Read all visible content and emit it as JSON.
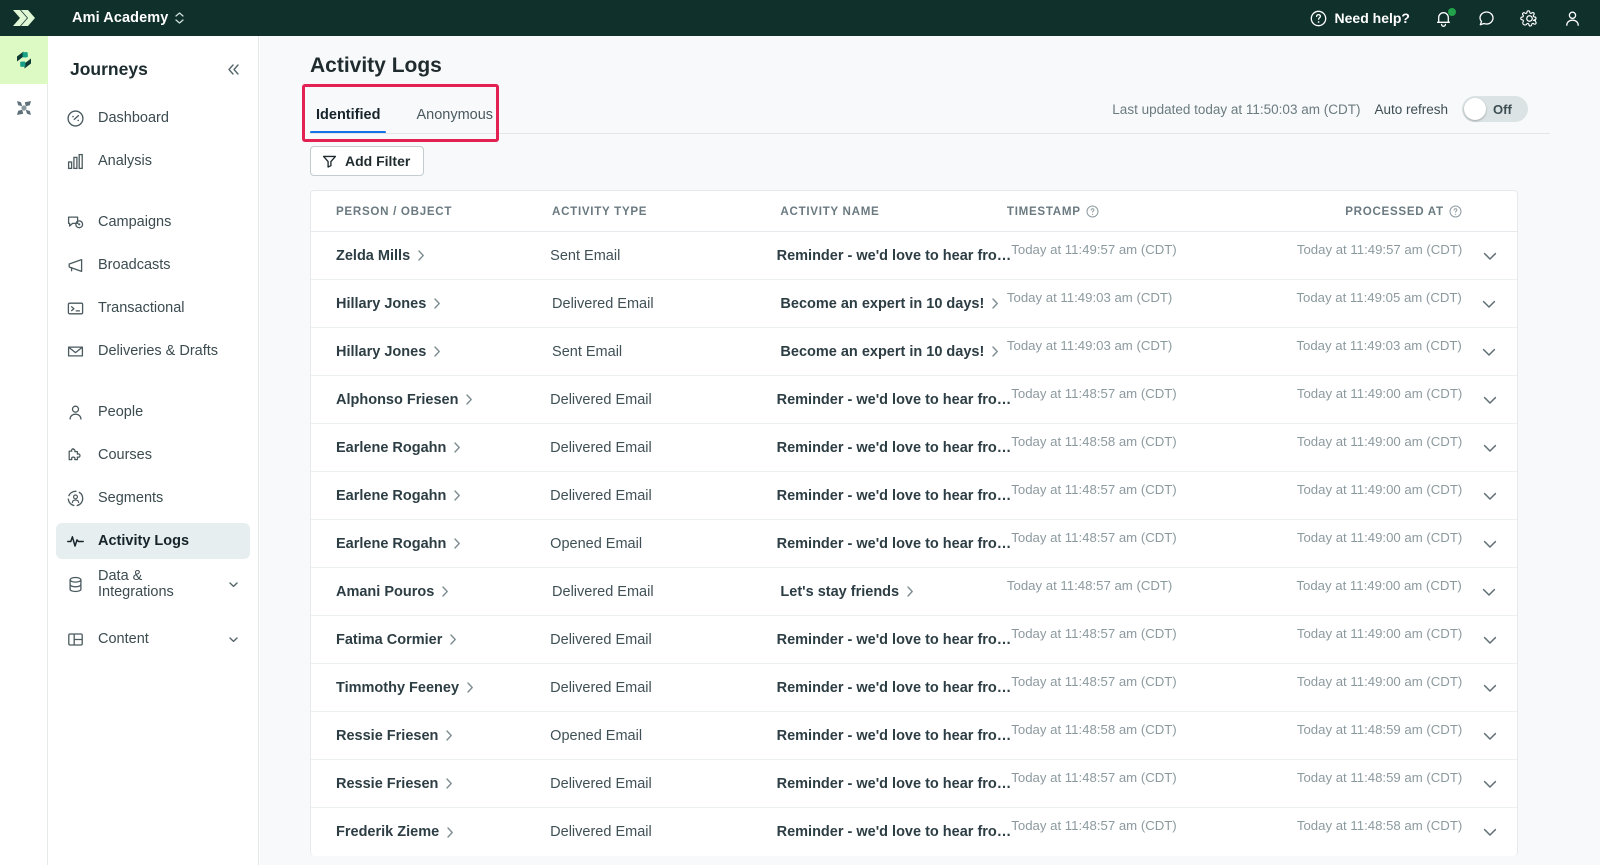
{
  "topbar": {
    "logo_icon": "brand-chevrons-icon",
    "org_name": "Ami Academy",
    "org_switch_icon": "up-down-chevrons-icon",
    "need_help": "Need help?",
    "help_icon": "question-circle-icon",
    "bell_icon": "bell-icon",
    "chat_icon": "chat-bubble-icon",
    "gear_icon": "gear-icon",
    "account_icon": "user-icon",
    "notification_dot_color": "#22a24a",
    "background": "#10302b"
  },
  "rail": {
    "items": [
      {
        "icon": "journeys-leaf-icon",
        "active": true
      },
      {
        "icon": "data-pipelines-x-icon",
        "active": false
      }
    ],
    "active_background": "#ddf9c4"
  },
  "sidebar": {
    "title": "Journeys",
    "collapse_icon": "double-chevron-left-icon",
    "items": [
      {
        "label": "Dashboard",
        "icon": "dashboard-gauge-icon",
        "active": false,
        "expandable": false
      },
      {
        "label": "Analysis",
        "icon": "bar-chart-icon",
        "active": false,
        "expandable": false
      },
      {
        "label": "Campaigns",
        "icon": "campaigns-icon",
        "active": false,
        "expandable": false
      },
      {
        "label": "Broadcasts",
        "icon": "megaphone-icon",
        "active": false,
        "expandable": false
      },
      {
        "label": "Transactional",
        "icon": "terminal-icon",
        "active": false,
        "expandable": false
      },
      {
        "label": "Deliveries & Drafts",
        "icon": "inbox-icon",
        "active": false,
        "expandable": false
      },
      {
        "label": "People",
        "icon": "person-icon",
        "active": false,
        "expandable": false
      },
      {
        "label": "Courses",
        "icon": "puzzle-icon",
        "active": false,
        "expandable": false
      },
      {
        "label": "Segments",
        "icon": "segments-circle-person-icon",
        "active": false,
        "expandable": false
      },
      {
        "label": "Activity Logs",
        "icon": "pulse-icon",
        "active": true,
        "expandable": false
      },
      {
        "label": "Data & Integrations",
        "icon": "database-icon",
        "active": false,
        "expandable": true
      },
      {
        "label": "Content",
        "icon": "content-layout-icon",
        "active": false,
        "expandable": true
      }
    ]
  },
  "main": {
    "page_title": "Activity Logs",
    "tabs": [
      {
        "label": "Identified",
        "active": true
      },
      {
        "label": "Anonymous",
        "active": false
      }
    ],
    "tab_highlight_color": "#e32253",
    "tab_active_underline_color": "#1673e6",
    "last_updated": "Last updated today at 11:50:03 am (CDT)",
    "auto_refresh_label": "Auto refresh",
    "auto_refresh_state": "Off",
    "add_filter": {
      "label": "Add Filter",
      "icon": "funnel-icon"
    },
    "table": {
      "columns": [
        {
          "label": "PERSON / OBJECT",
          "info_icon": false
        },
        {
          "label": "ACTIVITY TYPE",
          "info_icon": false
        },
        {
          "label": "ACTIVITY NAME",
          "info_icon": false
        },
        {
          "label": "TIMESTAMP",
          "info_icon": true
        },
        {
          "label": "PROCESSED AT",
          "info_icon": true
        }
      ],
      "row_chevron_icon": "chevron-down-icon",
      "link_chevron_icon": "chevron-right-icon",
      "rows": [
        {
          "person": "Zelda Mills",
          "type": "Sent Email",
          "name": "Reminder - we'd love to hear fro…",
          "name_link": false,
          "timestamp": "Today at 11:49:57 am (CDT)",
          "processed_at": "Today at 11:49:57 am (CDT)"
        },
        {
          "person": "Hillary Jones",
          "type": "Delivered Email",
          "name": "Become an expert in 10 days!",
          "name_link": true,
          "timestamp": "Today at 11:49:03 am (CDT)",
          "processed_at": "Today at 11:49:05 am (CDT)"
        },
        {
          "person": "Hillary Jones",
          "type": "Sent Email",
          "name": "Become an expert in 10 days!",
          "name_link": true,
          "timestamp": "Today at 11:49:03 am (CDT)",
          "processed_at": "Today at 11:49:03 am (CDT)"
        },
        {
          "person": "Alphonso Friesen",
          "type": "Delivered Email",
          "name": "Reminder - we'd love to hear fro…",
          "name_link": false,
          "timestamp": "Today at 11:48:57 am (CDT)",
          "processed_at": "Today at 11:49:00 am (CDT)"
        },
        {
          "person": "Earlene Rogahn",
          "type": "Delivered Email",
          "name": "Reminder - we'd love to hear fro…",
          "name_link": false,
          "timestamp": "Today at 11:48:58 am (CDT)",
          "processed_at": "Today at 11:49:00 am (CDT)"
        },
        {
          "person": "Earlene Rogahn",
          "type": "Delivered Email",
          "name": "Reminder - we'd love to hear fro…",
          "name_link": false,
          "timestamp": "Today at 11:48:57 am (CDT)",
          "processed_at": "Today at 11:49:00 am (CDT)"
        },
        {
          "person": "Earlene Rogahn",
          "type": "Opened Email",
          "name": "Reminder - we'd love to hear fro…",
          "name_link": false,
          "timestamp": "Today at 11:48:57 am (CDT)",
          "processed_at": "Today at 11:49:00 am (CDT)"
        },
        {
          "person": "Amani Pouros",
          "type": "Delivered Email",
          "name": "Let's stay friends",
          "name_link": true,
          "timestamp": "Today at 11:48:57 am (CDT)",
          "processed_at": "Today at 11:49:00 am (CDT)"
        },
        {
          "person": "Fatima Cormier",
          "type": "Delivered Email",
          "name": "Reminder - we'd love to hear fro…",
          "name_link": false,
          "timestamp": "Today at 11:48:57 am (CDT)",
          "processed_at": "Today at 11:49:00 am (CDT)"
        },
        {
          "person": "Timmothy Feeney",
          "type": "Delivered Email",
          "name": "Reminder - we'd love to hear fro…",
          "name_link": false,
          "timestamp": "Today at 11:48:57 am (CDT)",
          "processed_at": "Today at 11:49:00 am (CDT)"
        },
        {
          "person": "Ressie Friesen",
          "type": "Opened Email",
          "name": "Reminder - we'd love to hear fro…",
          "name_link": false,
          "timestamp": "Today at 11:48:58 am (CDT)",
          "processed_at": "Today at 11:48:59 am (CDT)"
        },
        {
          "person": "Ressie Friesen",
          "type": "Delivered Email",
          "name": "Reminder - we'd love to hear fro…",
          "name_link": false,
          "timestamp": "Today at 11:48:57 am (CDT)",
          "processed_at": "Today at 11:48:59 am (CDT)"
        },
        {
          "person": "Frederik Zieme",
          "type": "Delivered Email",
          "name": "Reminder - we'd love to hear fro…",
          "name_link": false,
          "timestamp": "Today at 11:48:57 am (CDT)",
          "processed_at": "Today at 11:48:58 am (CDT)"
        }
      ]
    }
  }
}
